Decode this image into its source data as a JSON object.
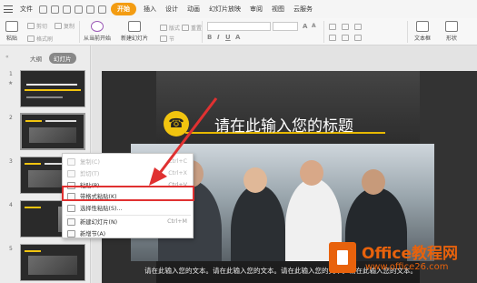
{
  "menubar": {
    "file_label": "文件",
    "tabs": [
      "开始",
      "插入",
      "设计",
      "动画",
      "幻灯片放映",
      "审阅",
      "视图",
      "云服务"
    ],
    "active_tab": "开始"
  },
  "ribbon": {
    "paste": "粘贴",
    "cut": "剪切",
    "copy": "复制",
    "format_painter": "格式刷",
    "play_from_current": "从当前开始",
    "new_slide": "新建幻灯片",
    "layout": "版式",
    "section": "节",
    "reset": "重置",
    "textbox": "文本框",
    "shape": "形状"
  },
  "left_panel": {
    "tabs": [
      "大纲",
      "幻灯片"
    ],
    "active_tab": "幻灯片",
    "slide_numbers": [
      "1",
      "2",
      "3",
      "4",
      "5"
    ],
    "thumb1_title": "提高时间与效率系统"
  },
  "slide": {
    "title": "请在此输入您的标题",
    "body": "请在此输入您的文本。请在此输入您的文本。请在此输入您的文本。请在此输入您的文本。",
    "phone_icon": "☎"
  },
  "context_menu": {
    "items": [
      {
        "label": "复制(C)",
        "shortcut": "Ctrl+C",
        "disabled": true
      },
      {
        "label": "剪切(T)",
        "shortcut": "Ctrl+X",
        "disabled": true
      },
      {
        "label": "粘贴(P)",
        "shortcut": "Ctrl+V",
        "disabled": false
      },
      {
        "label": "带格式粘贴(K)",
        "shortcut": "",
        "disabled": false
      },
      {
        "label": "选择性粘贴(S)...",
        "shortcut": "",
        "disabled": false
      },
      {
        "label": "新建幻灯片(N)",
        "shortcut": "Ctrl+M",
        "disabled": false
      },
      {
        "label": "新增节(A)",
        "shortcut": "",
        "disabled": false
      }
    ],
    "highlighted": "带格式粘贴(K)"
  },
  "watermark": {
    "line1": "Office教程网",
    "line2": "www.office26.com"
  },
  "colors": {
    "accent": "#f39c12",
    "highlight_box": "#e03131",
    "gold": "#f1c40f",
    "watermark": "#e8620c"
  }
}
